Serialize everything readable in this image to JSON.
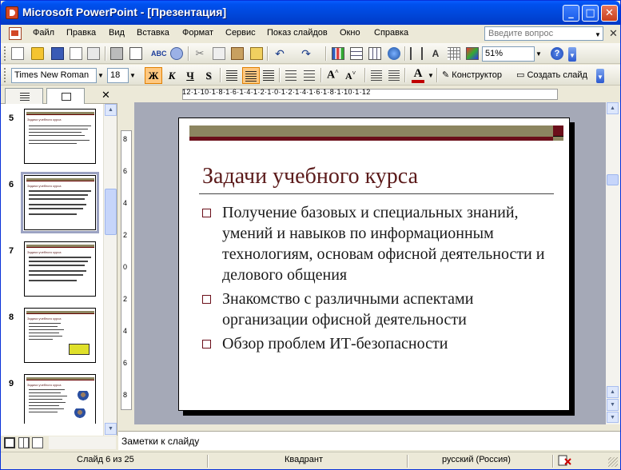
{
  "window": {
    "title": "Microsoft PowerPoint - [Презентация]",
    "minimize": "_",
    "maximize": "□",
    "close": "✕"
  },
  "menu": {
    "items": [
      "Файл",
      "Правка",
      "Вид",
      "Вставка",
      "Формат",
      "Сервис",
      "Показ слайдов",
      "Окно",
      "Справка"
    ],
    "help_placeholder": "Введите вопрос",
    "doc_close": "✕"
  },
  "toolbar_standard": {
    "zoom": "51%"
  },
  "toolbar_formatting": {
    "font": "Times New Roman",
    "size": "18",
    "bold": "Ж",
    "italic": "К",
    "underline": "Ч",
    "shadow": "S",
    "font_color": "A",
    "designer": "Конструктор",
    "new_slide": "Создать слайд"
  },
  "left_panel": {
    "close": "✕",
    "thumbnails": [
      {
        "number": "5",
        "title": "Задачи учебного курса",
        "selected": false
      },
      {
        "number": "6",
        "title": "Задачи учебного курса",
        "selected": true
      },
      {
        "number": "7",
        "title": "Задачи учебного курса",
        "selected": false
      },
      {
        "number": "8",
        "title": "Задачи учебного курса",
        "selected": false
      },
      {
        "number": "9",
        "title": "Задачи учебного курса",
        "selected": false
      }
    ]
  },
  "ruler": {
    "horizontal": "12·1·10·1·8·1·6·1·4·1·2·1·0·1·2·1·4·1·6·1·8·1·10·1·12",
    "vertical": [
      "8",
      "6",
      "4",
      "2",
      "0",
      "2",
      "4",
      "6",
      "8"
    ]
  },
  "slide": {
    "title": "Задачи учебного курса",
    "bullets": [
      "Получение базовых и специальных знаний, умений и навыков по информационным технологиям, основам офисной деятельности и делового общения",
      "Знакомство с различными аспектами организации офисной деятельности",
      "Обзор проблем ИТ-безопасности"
    ]
  },
  "notes": {
    "placeholder": "Заметки к слайду"
  },
  "status": {
    "slide_counter": "Слайд 6 из 25",
    "design": "Квадрант",
    "language": "русский (Россия)"
  },
  "colors": {
    "title_bar": "#0050ee",
    "slide_title": "#5b1a1a",
    "accent_dark_red": "#6b0f1a",
    "accent_olive": "#8c8560",
    "workspace": "#a5a9b7"
  }
}
